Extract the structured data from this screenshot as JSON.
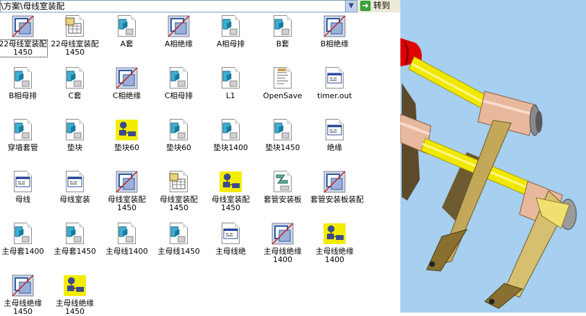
{
  "address_bar": {
    "path": "\\方案\\母线室装配",
    "go_label": "转到"
  },
  "files": [
    {
      "label": "22母线室装配1450",
      "icon": "assembly-icon",
      "selected": true
    },
    {
      "label": "22母线室装配1450",
      "icon": "drawing-icon"
    },
    {
      "label": "A套",
      "icon": "part-icon"
    },
    {
      "label": "A相绝缘",
      "icon": "assembly-icon"
    },
    {
      "label": "A相母排",
      "icon": "part-icon"
    },
    {
      "label": "B套",
      "icon": "part-icon"
    },
    {
      "label": "B相绝缘",
      "icon": "assembly-icon"
    },
    {
      "label": "B相母排",
      "icon": "part-icon"
    },
    {
      "label": "C套",
      "icon": "part-icon"
    },
    {
      "label": "C相绝缘",
      "icon": "assembly-icon"
    },
    {
      "label": "C相母排",
      "icon": "part-icon"
    },
    {
      "label": "L1",
      "icon": "part-icon"
    },
    {
      "label": "OpenSave",
      "icon": "text-file-icon"
    },
    {
      "label": "timer.out",
      "icon": "window-file-icon"
    },
    {
      "label": "穿墙套管",
      "icon": "part-icon"
    },
    {
      "label": "垫块",
      "icon": "part-icon"
    },
    {
      "label": "垫块60",
      "icon": "yellow-assembly-icon"
    },
    {
      "label": "垫块60",
      "icon": "part-icon"
    },
    {
      "label": "垫块1400",
      "icon": "part-icon"
    },
    {
      "label": "垫块1450",
      "icon": "part-icon"
    },
    {
      "label": "绝缘",
      "icon": "window-file-icon"
    },
    {
      "label": "母线",
      "icon": "window-file-icon"
    },
    {
      "label": "母线室装",
      "icon": "window-file-icon"
    },
    {
      "label": "母线室装配1450",
      "icon": "assembly-icon"
    },
    {
      "label": "母线室装配1450",
      "icon": "drawing-icon"
    },
    {
      "label": "母线室装配1450",
      "icon": "yellow-assembly-icon"
    },
    {
      "label": "套管安装板",
      "icon": "sheetmetal-icon"
    },
    {
      "label": "套管安装板装配",
      "icon": "assembly-icon"
    },
    {
      "label": "主母套1400",
      "icon": "part-icon"
    },
    {
      "label": "主母套1450",
      "icon": "part-icon"
    },
    {
      "label": "主母线1400",
      "icon": "part-icon"
    },
    {
      "label": "主母线1450",
      "icon": "part-icon"
    },
    {
      "label": "主母线绝",
      "icon": "window-file-icon"
    },
    {
      "label": "主母线绝缘1400",
      "icon": "assembly-icon"
    },
    {
      "label": "主母线绝缘1400",
      "icon": "yellow-assembly-icon"
    },
    {
      "label": "主母线绝缘1450",
      "icon": "assembly-icon"
    },
    {
      "label": "主母线绝缘1450",
      "icon": "yellow-assembly-icon"
    }
  ],
  "colors": {
    "viewport_bg": "#a6cff0",
    "busbar": "#f0e800",
    "bracket": "#c4a85a",
    "sleeve": "#e8b89c",
    "insulator_red": "#e00000"
  }
}
